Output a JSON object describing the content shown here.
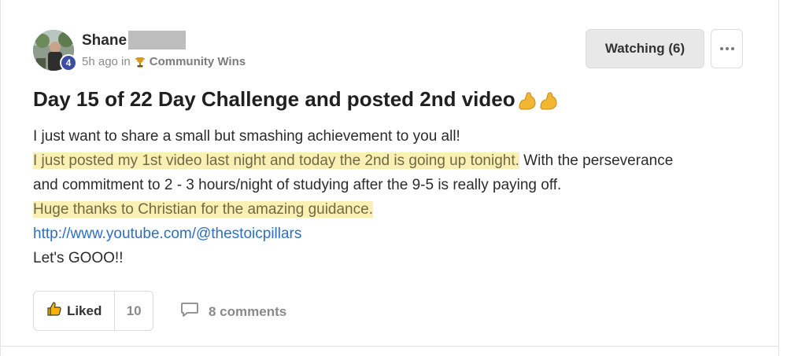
{
  "author": {
    "name": "Shane",
    "level": "4"
  },
  "meta": {
    "time": "5h ago in",
    "category": "Community Wins",
    "category_icon": "trophy-icon"
  },
  "actions": {
    "watch_label": "Watching (6)",
    "more_icon": "more-dots-icon"
  },
  "post": {
    "title": "Day 15 of 22 Day Challenge and posted 2nd video",
    "title_emoji": "flexed-biceps-icon",
    "line1": "I just want to share a small but smashing achievement to you all!",
    "line2_highlight": "I just posted my 1st video last night and today the 2nd is going up tonight.",
    "line2_rest": " With the perseverance",
    "line3": "and commitment to 2 - 3 hours/night of studying after the 9-5 is really paying off.",
    "line4_highlight": "Huge thanks to Christian for the amazing guidance.",
    "link": "http://www.youtube.com/@thestoicpillars",
    "closing": "Let's GOOO!!"
  },
  "footer": {
    "like_label": "Liked",
    "like_count": "10",
    "comments_label": "8 comments"
  },
  "colors": {
    "highlight": "#fbf0b4",
    "link": "#2d6fc7",
    "badge": "#3b4ea3"
  }
}
